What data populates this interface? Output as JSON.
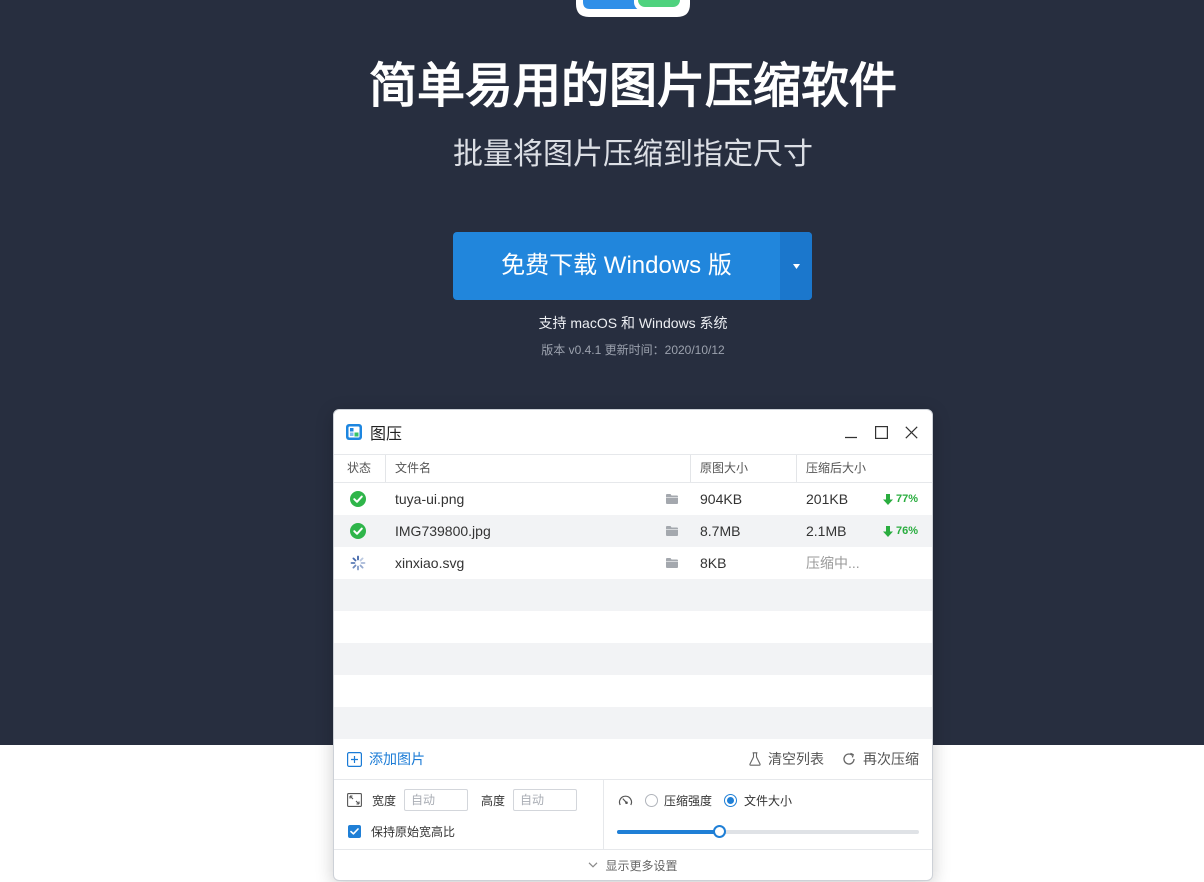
{
  "colors": {
    "hero_background": "#272e3f",
    "accent": "#2186dc",
    "accent_secondary": "#1f7fd6",
    "success": "#2aad3f"
  },
  "hero": {
    "logo_icon": "tuya-app-logo-icon",
    "title": "简单易用的图片压缩软件",
    "subtitle": "批量将图片压缩到指定尺寸",
    "download_label": "免费下载 Windows 版",
    "dropdown_icon": "caret-down-icon",
    "support_text": "支持 macOS 和 Windows 系统",
    "version_text": "版本 v0.4.1 更新时间：2020/10/12"
  },
  "window": {
    "app_icon": "tuya-app-icon",
    "title": "图压",
    "controls": [
      "minimize-icon",
      "maximize-icon",
      "close-icon"
    ],
    "columns": {
      "status": "状态",
      "filename": "文件名",
      "original_size": "原图大小",
      "compressed_size": "压缩后大小"
    },
    "files": [
      {
        "icon": "check-circle-icon",
        "name": "tuya-ui.png",
        "original": "904KB",
        "compressed": "201KB",
        "ratio": "77%"
      },
      {
        "icon": "check-circle-icon",
        "name": "IMG739800.jpg",
        "original": "8.7MB",
        "compressed": "2.1MB",
        "ratio": "76%"
      },
      {
        "icon": "spinner-icon",
        "name": "xinxiao.svg",
        "original": "8KB",
        "compressed": "压缩中..."
      }
    ],
    "toolbar": {
      "add_label": "添加图片",
      "clear_label": "清空列表",
      "recompress_label": "再次压缩"
    },
    "settings": {
      "width_label": "宽度",
      "width_placeholder": "自动",
      "height_label": "高度",
      "height_placeholder": "自动",
      "keep_ratio_label": "保持原始宽高比",
      "keep_ratio_checked": true,
      "mode_options": [
        "压缩强度",
        "文件大小"
      ],
      "mode_selected_index": 1,
      "slider_value": 0.34
    },
    "more_settings_label": "显示更多设置"
  }
}
